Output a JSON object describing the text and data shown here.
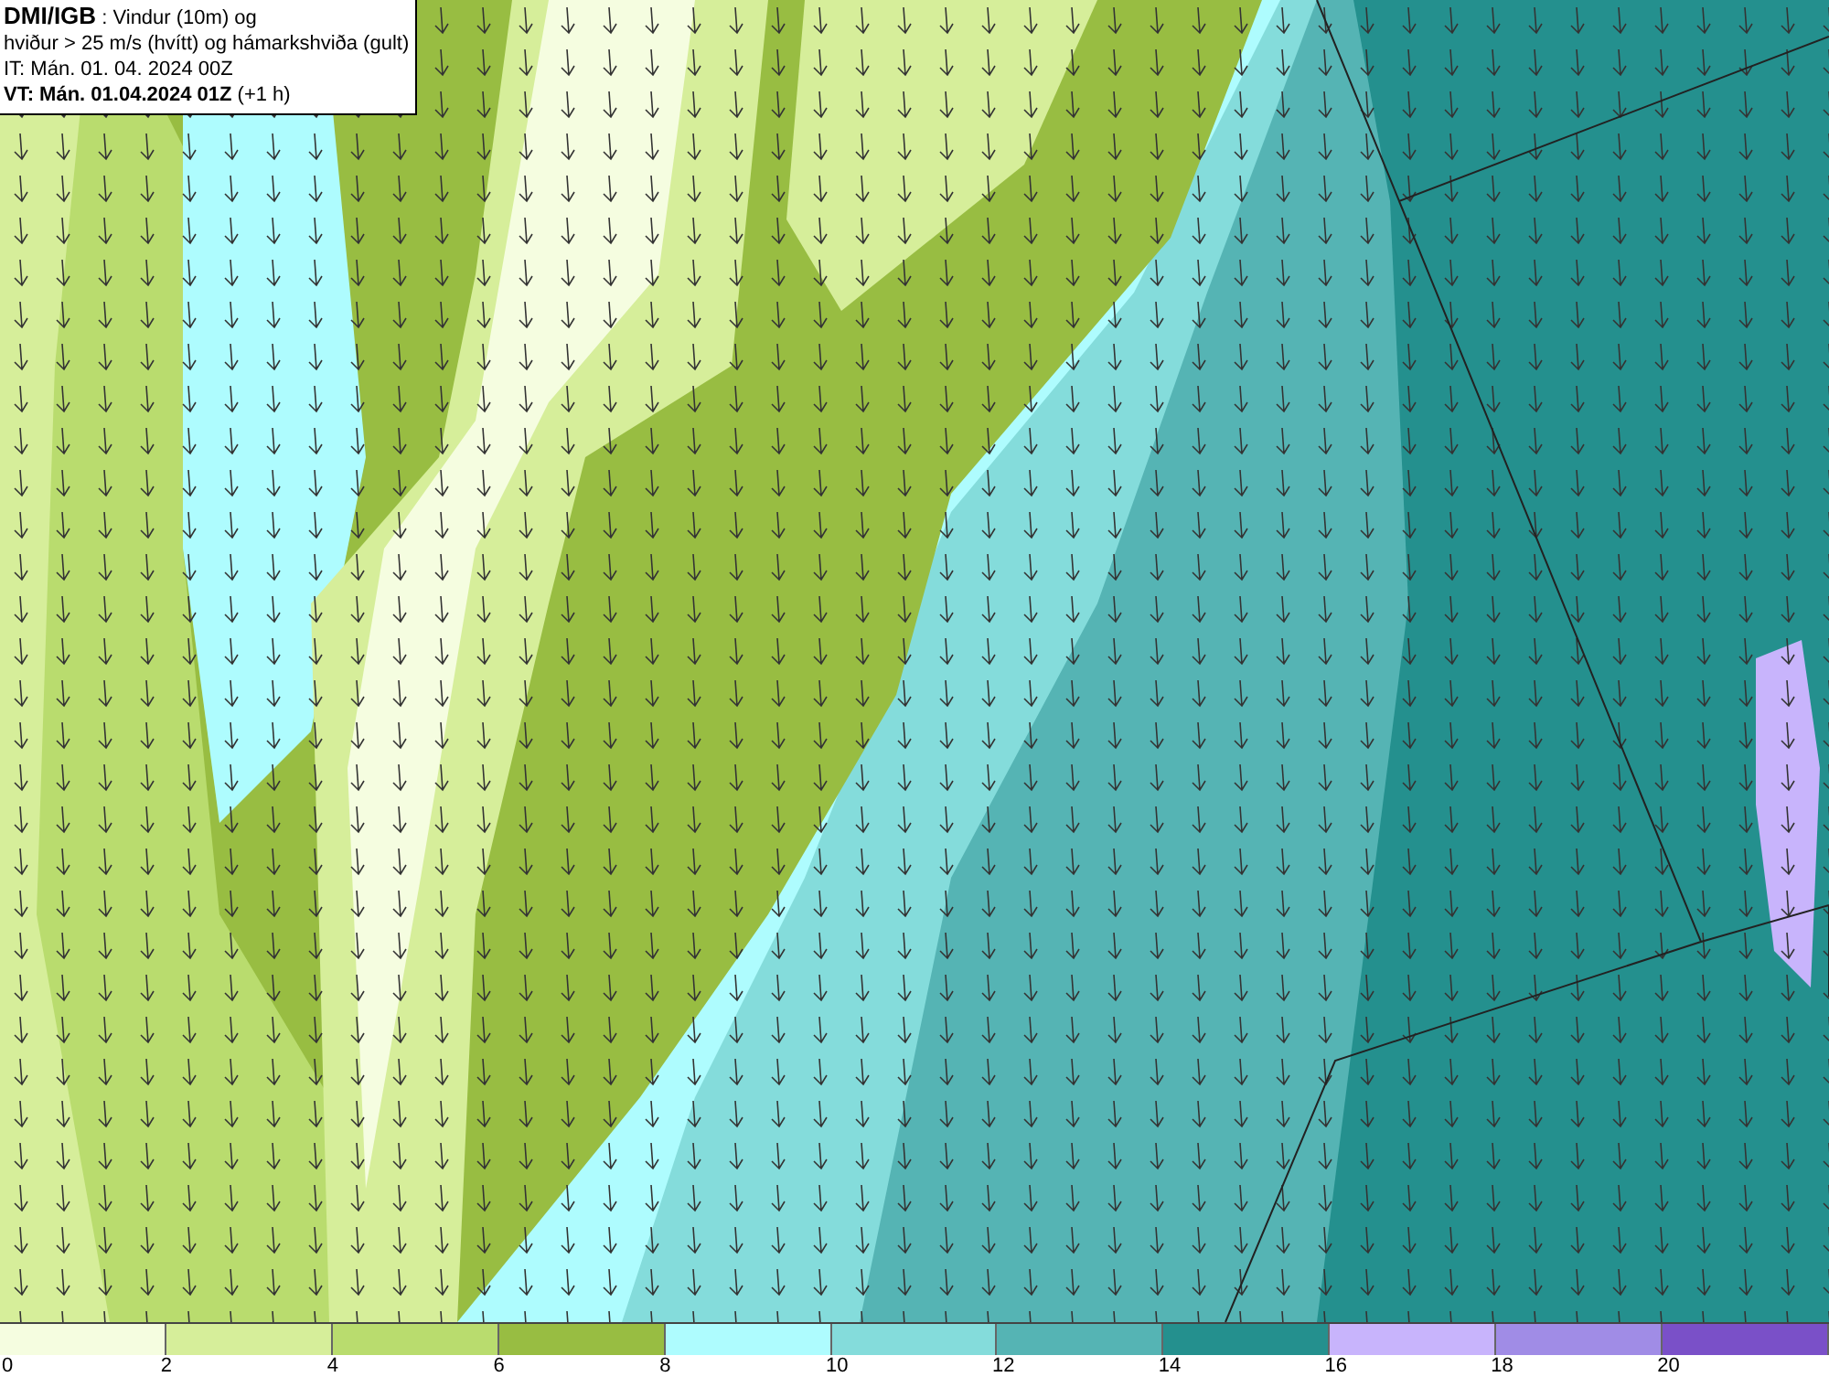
{
  "title_box": {
    "lines": [
      "**DMI/IGB** : Vindur (10m) og",
      "hviður > 25 m/s (hvítt) og hámarkshviða (gult)",
      "IT: Mán. 01. 04. 2024 00Z",
      "**VT: Mán. 01.04.2024 01Z** (+1 h)"
    ]
  },
  "legend": {
    "bins": [
      {
        "color": "#f5fde0"
      },
      {
        "color": "#d6ee9a"
      },
      {
        "color": "#b9dc6e"
      },
      {
        "color": "#98bd42"
      },
      {
        "color": "#aefcfe"
      },
      {
        "color": "#84dcdb"
      },
      {
        "color": "#55b4b4"
      },
      {
        "color": "#24908e"
      },
      {
        "color": "#c8b4fc"
      },
      {
        "color": "#a08ce6"
      },
      {
        "color": "#7a50c8"
      }
    ],
    "ticks": [
      "0",
      "2",
      "4",
      "6",
      "8",
      "10",
      "12",
      "14",
      "16",
      "18",
      "20"
    ]
  }
}
